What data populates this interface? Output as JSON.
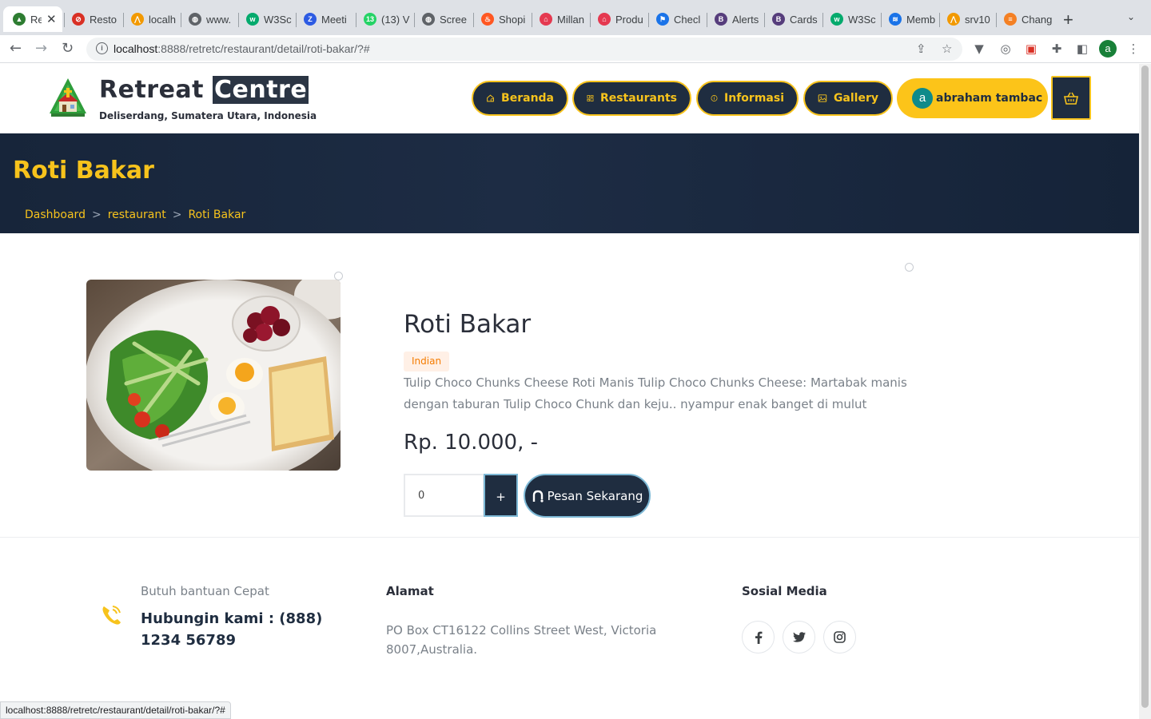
{
  "browser": {
    "tabs": [
      {
        "title": "Re",
        "color": "#2e7d32",
        "glyph": "▲",
        "active": true
      },
      {
        "title": "Resto",
        "color": "#d93025",
        "glyph": "⊘"
      },
      {
        "title": "localh",
        "color": "#f29900",
        "glyph": "⋀"
      },
      {
        "title": "www.",
        "color": "#5f6368",
        "glyph": "◍"
      },
      {
        "title": "W3Sc",
        "color": "#04aa6d",
        "glyph": "w"
      },
      {
        "title": "Meeti",
        "color": "#2d5be3",
        "glyph": "Z"
      },
      {
        "title": "(13) V",
        "color": "#25d366",
        "glyph": "13"
      },
      {
        "title": "Scree",
        "color": "#5f6368",
        "glyph": "◍"
      },
      {
        "title": "Shopi",
        "color": "#ff5722",
        "glyph": "♨"
      },
      {
        "title": "Millan",
        "color": "#e53950",
        "glyph": "⌂"
      },
      {
        "title": "Produ",
        "color": "#e53950",
        "glyph": "⌂"
      },
      {
        "title": "Checl",
        "color": "#1a73e8",
        "glyph": "⚑"
      },
      {
        "title": "Alerts",
        "color": "#563d7c",
        "glyph": "B"
      },
      {
        "title": "Cards",
        "color": "#563d7c",
        "glyph": "B"
      },
      {
        "title": "W3Sc",
        "color": "#04aa6d",
        "glyph": "w"
      },
      {
        "title": "Memb",
        "color": "#1a73e8",
        "glyph": "≋"
      },
      {
        "title": "srv10",
        "color": "#f29900",
        "glyph": "⋀"
      },
      {
        "title": "Chang",
        "color": "#f48024",
        "glyph": "≡"
      }
    ],
    "close_glyph": "✕",
    "new_tab_glyph": "+",
    "url_host": "localhost",
    "url_path": ":8888/retretc/restaurant/detail/roti-bakar/?#",
    "profile_initial": "a",
    "status_url": "localhost:8888/retretc/restaurant/detail/roti-bakar/?#"
  },
  "header": {
    "brand_part1": "Retreat",
    "brand_part2": "Centre",
    "brand_subtitle": "Deliserdang, Sumatera Utara, Indonesia",
    "nav": [
      {
        "label": "Beranda",
        "icon": "home-icon"
      },
      {
        "label": "Restaurants",
        "icon": "layout-icon"
      },
      {
        "label": "Informasi",
        "icon": "info-icon"
      },
      {
        "label": "Gallery",
        "icon": "image-icon"
      }
    ],
    "user_initial": "a",
    "user_name": "abraham tambac"
  },
  "hero": {
    "title": "Roti Bakar",
    "breadcrumb": [
      "Dashboard",
      "restaurant",
      "Roti Bakar"
    ],
    "breadcrumb_sep": ">"
  },
  "product": {
    "name": "Roti Bakar",
    "category": "Indian",
    "description": "Tulip Choco Chunks Cheese Roti Manis Tulip Choco Chunks Cheese: Martabak manis dengan taburan Tulip Choco Chunk dan keju.. nyampur enak banget di mulut",
    "price": "Rp. 10.000, -",
    "quantity": "0",
    "plus_label": "+",
    "order_label": "Pesan Sekarang"
  },
  "footer": {
    "help_small": "Butuh bantuan Cepat",
    "help_big": "Hubungin kami : (888) 1234 56789",
    "address_heading": "Alamat",
    "address": "PO Box CT16122 Collins Street West, Victoria 8007,Australia.",
    "social_heading": "Sosial Media",
    "social": [
      "facebook-icon",
      "twitter-icon",
      "instagram-icon"
    ]
  },
  "colors": {
    "accent": "#f7c31c",
    "navy": "#1f2d40",
    "user_pill": "#fcc419"
  }
}
